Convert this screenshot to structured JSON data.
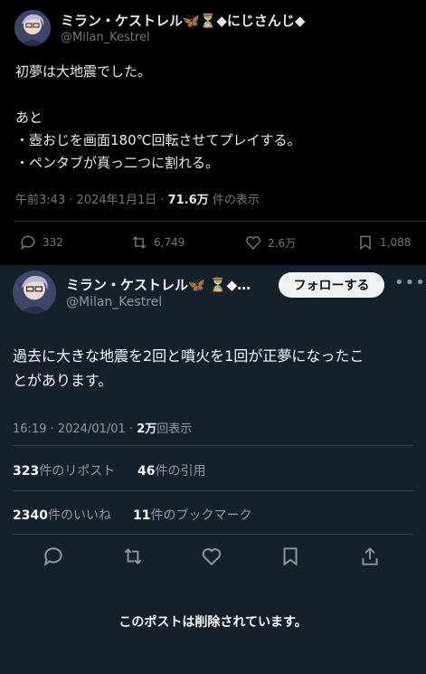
{
  "tweet_top": {
    "name": "ミラン・ケストレル🦋⏳◆にじさんじ◆",
    "handle": "@Milan_Kestrel",
    "line1": "初夢は大地震でした。",
    "line2": "あと",
    "line3": "・壺おじを画面180℃回転させてプレイする。",
    "line4": "・ペンタブが真っ二つに割れる。",
    "time": "午前3:43 · 2024年1月1日 · ",
    "views": "71.6万",
    "views_suffix": " 件の表示",
    "replies": "332",
    "retweets": "6,749",
    "likes": "2.6万",
    "bookmarks": "1,088"
  },
  "tweet_bottom": {
    "name": "ミラン・ケストレル🦋 ⏳◆…",
    "handle": "@Milan_Kestrel",
    "follow_label": "フォローする",
    "more": "•••",
    "text1": "過去に大きな地震を2回と噴火を1回が正夢になったこ",
    "text2": "とがあります。",
    "time": "16:19 · 2024/01/01 · ",
    "views": "2万",
    "views_suffix": "回表示",
    "reposts_count": "323",
    "reposts_label": "件のリポスト",
    "quotes_count": "46",
    "quotes_label": "件の引用",
    "likes_count": "2340",
    "likes_label": "件のいいね",
    "bookmarks_count": "11",
    "bookmarks_label": "件のブックマーク",
    "deleted_notice": "このポストは削除されています。"
  }
}
